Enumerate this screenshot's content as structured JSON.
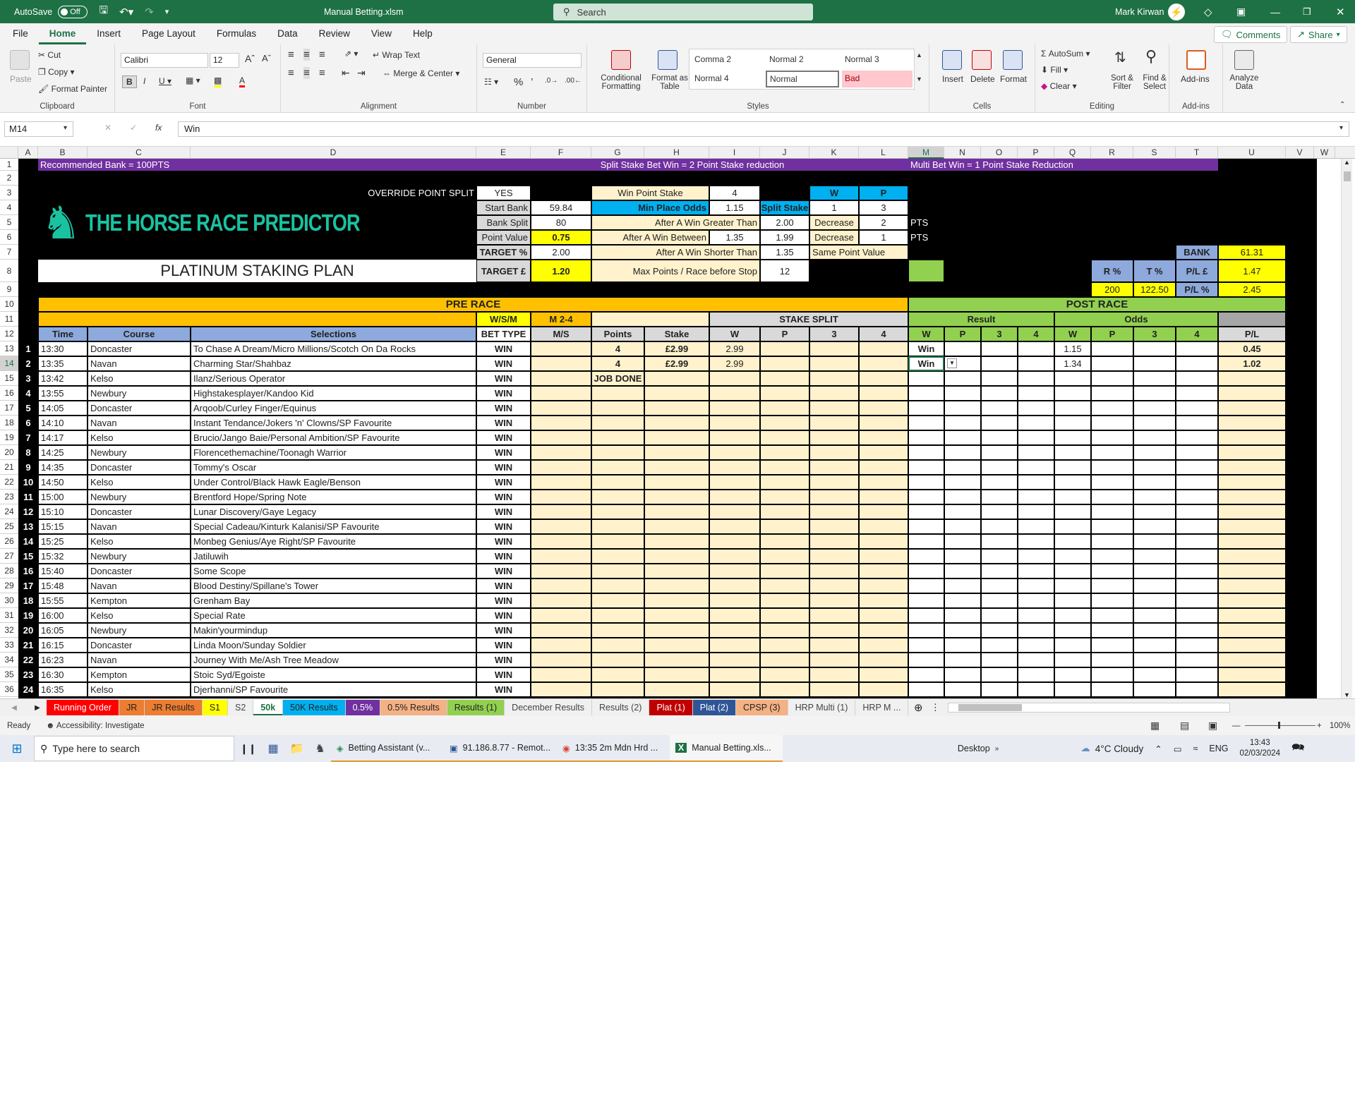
{
  "titlebar": {
    "autosave_label": "AutoSave",
    "autosave_state": "Off",
    "filename": "Manual Betting.xlsm",
    "search_placeholder": "Search",
    "user": "Mark Kirwan"
  },
  "menu": {
    "tabs": [
      "File",
      "Home",
      "Insert",
      "Page Layout",
      "Formulas",
      "Data",
      "Review",
      "View",
      "Help"
    ],
    "comments": "Comments",
    "share": "Share"
  },
  "ribbon": {
    "clipboard": {
      "label": "Clipboard",
      "paste": "Paste",
      "cut": "Cut",
      "copy": "Copy",
      "format_painter": "Format Painter"
    },
    "font": {
      "label": "Font",
      "font_name": "Calibri",
      "font_size": "12"
    },
    "alignment": {
      "label": "Alignment",
      "wrap": "Wrap Text",
      "merge": "Merge & Center"
    },
    "number": {
      "label": "Number",
      "format": "General"
    },
    "styles": {
      "label": "Styles",
      "conditional": "Conditional Formatting",
      "format_table": "Format as Table",
      "cells": [
        "Comma 2",
        "Normal 2",
        "Normal 3",
        "Normal 4",
        "Normal",
        "Bad"
      ]
    },
    "cells": {
      "label": "Cells",
      "insert": "Insert",
      "delete": "Delete",
      "format": "Format"
    },
    "editing": {
      "label": "Editing",
      "autosum": "AutoSum",
      "fill": "Fill",
      "clear": "Clear",
      "sort": "Sort & Filter",
      "find": "Find & Select"
    },
    "addins": {
      "label": "Add-ins",
      "addins": "Add-ins",
      "analyze": "Analyze Data"
    }
  },
  "formula_bar": {
    "namebox": "M14",
    "formula": "Win"
  },
  "columns": [
    "A",
    "B",
    "C",
    "D",
    "E",
    "F",
    "G",
    "H",
    "I",
    "J",
    "K",
    "L",
    "M",
    "N",
    "O",
    "P",
    "Q",
    "R",
    "S",
    "T",
    "U",
    "V",
    "W"
  ],
  "rows": [
    "1",
    "2",
    "3",
    "4",
    "5",
    "6",
    "7",
    "8",
    "9",
    "10",
    "11",
    "12",
    "13",
    "14",
    "15",
    "16",
    "17",
    "18",
    "19",
    "20",
    "21",
    "22",
    "23",
    "24",
    "25",
    "26",
    "27",
    "28",
    "29",
    "30",
    "31",
    "32",
    "33",
    "34",
    "35",
    "36"
  ],
  "sheet": {
    "banner": {
      "left": "Recommended Bank = 100PTS",
      "mid": "Split Stake Bet Win = 2 Point Stake reduction",
      "right": "Multi Bet Win = 1 Point  Stake Reduction"
    },
    "logo_title": "THE HORSE RACE PREDICTOR",
    "plan_title": "PLATINUM STAKING PLAN",
    "settings": {
      "override_label": "OVERRIDE POINT SPLIT",
      "override_val": "YES",
      "start_bank_label": "Start Bank",
      "start_bank": "59.84",
      "bank_split_label": "Bank Split",
      "bank_split": "80",
      "point_value_label": "Point Value",
      "point_value": "0.75",
      "target_pct_label": "TARGET %",
      "target_pct": "2.00",
      "target_gbp_label": "TARGET £",
      "target_gbp": "1.20",
      "win_point_stake_label": "Win Point Stake",
      "win_point_stake": "4",
      "min_place_odds_label": "Min Place Odds",
      "min_place_odds": "1.15",
      "after_win_greater_label": "After A Win Greater Than",
      "after_win_greater": "2.00",
      "after_win_between_label": "After A Win Between",
      "after_win_between": "1.35",
      "after_win_between_2": "1.99",
      "after_win_shorter_label": "After A Win Shorter Than",
      "after_win_shorter": "1.35",
      "max_points_label": "Max Points / Race before Stop",
      "max_points": "12",
      "split_stake_label": "Split Stake",
      "w_label": "W",
      "p_label": "P",
      "split_w": "1",
      "split_p": "3",
      "decrease_label": "Decrease",
      "decrease_1": "2",
      "decrease_2": "1",
      "pts": "PTS",
      "same_point": "Same Point Value"
    },
    "summary": {
      "bank_label": "BANK",
      "bank": "61.31",
      "r_pct_label": "R %",
      "t_pct_label": "T %",
      "pl_gbp_label": "P/L  £",
      "pl_gbp": "1.47",
      "r_pct": "200",
      "t_pct": "122.50",
      "pl_pct_label": "P/L %",
      "pl_pct": "2.45"
    },
    "headers": {
      "pre_race": "PRE RACE",
      "post_race": "POST RACE",
      "wsm": "W/S/M",
      "m24": "M 2-4",
      "stake_split": "STAKE SPLIT",
      "result": "Result",
      "odds": "Odds",
      "time": "Time",
      "course": "Course",
      "selections": "Selections",
      "bet_type": "BET TYPE",
      "ms": "M/S",
      "points": "Points",
      "stake": "Stake",
      "w": "W",
      "p": "P",
      "three": "3",
      "four": "4",
      "pl": "P/L"
    },
    "races": [
      {
        "n": "1",
        "time": "13:30",
        "course": "Doncaster",
        "sel": "To Chase A Dream/Micro Millions/Scotch On Da Rocks",
        "bet": "WIN",
        "points": "4",
        "stake": "£2.99",
        "sw": "2.99",
        "res": "Win",
        "odds": "1.15",
        "pl": "0.45"
      },
      {
        "n": "2",
        "time": "13:35",
        "course": "Navan",
        "sel": "Charming Star/Shahbaz",
        "bet": "WIN",
        "points": "4",
        "stake": "£2.99",
        "sw": "2.99",
        "res": "Win",
        "odds": "1.34",
        "pl": "1.02"
      },
      {
        "n": "3",
        "time": "13:42",
        "course": "Kelso",
        "sel": "Ilanz/Serious Operator",
        "bet": "WIN",
        "points": "JOB DONE",
        "stake": "",
        "sw": "",
        "res": "",
        "odds": "",
        "pl": ""
      },
      {
        "n": "4",
        "time": "13:55",
        "course": "Newbury",
        "sel": "Highstakesplayer/Kandoo Kid",
        "bet": "WIN",
        "points": "",
        "stake": "",
        "sw": "",
        "res": "",
        "odds": "",
        "pl": ""
      },
      {
        "n": "5",
        "time": "14:05",
        "course": "Doncaster",
        "sel": "Arqoob/Curley Finger/Equinus",
        "bet": "WIN",
        "points": "",
        "stake": "",
        "sw": "",
        "res": "",
        "odds": "",
        "pl": ""
      },
      {
        "n": "6",
        "time": "14:10",
        "course": "Navan",
        "sel": "Instant Tendance/Jokers 'n' Clowns/SP Favourite",
        "bet": "WIN",
        "points": "",
        "stake": "",
        "sw": "",
        "res": "",
        "odds": "",
        "pl": ""
      },
      {
        "n": "7",
        "time": "14:17",
        "course": "Kelso",
        "sel": "Brucio/Jango Baie/Personal Ambition/SP Favourite",
        "bet": "WIN",
        "points": "",
        "stake": "",
        "sw": "",
        "res": "",
        "odds": "",
        "pl": ""
      },
      {
        "n": "8",
        "time": "14:25",
        "course": "Newbury",
        "sel": "Florencethemachine/Toonagh Warrior",
        "bet": "WIN",
        "points": "",
        "stake": "",
        "sw": "",
        "res": "",
        "odds": "",
        "pl": ""
      },
      {
        "n": "9",
        "time": "14:35",
        "course": "Doncaster",
        "sel": "Tommy's Oscar",
        "bet": "WIN",
        "points": "",
        "stake": "",
        "sw": "",
        "res": "",
        "odds": "",
        "pl": ""
      },
      {
        "n": "10",
        "time": "14:50",
        "course": "Kelso",
        "sel": "Under Control/Black Hawk Eagle/Benson",
        "bet": "WIN",
        "points": "",
        "stake": "",
        "sw": "",
        "res": "",
        "odds": "",
        "pl": ""
      },
      {
        "n": "11",
        "time": "15:00",
        "course": "Newbury",
        "sel": "Brentford Hope/Spring Note",
        "bet": "WIN",
        "points": "",
        "stake": "",
        "sw": "",
        "res": "",
        "odds": "",
        "pl": ""
      },
      {
        "n": "12",
        "time": "15:10",
        "course": "Doncaster",
        "sel": "Lunar Discovery/Gaye Legacy",
        "bet": "WIN",
        "points": "",
        "stake": "",
        "sw": "",
        "res": "",
        "odds": "",
        "pl": ""
      },
      {
        "n": "13",
        "time": "15:15",
        "course": "Navan",
        "sel": "Special Cadeau/Kinturk Kalanisi/SP Favourite",
        "bet": "WIN",
        "points": "",
        "stake": "",
        "sw": "",
        "res": "",
        "odds": "",
        "pl": ""
      },
      {
        "n": "14",
        "time": "15:25",
        "course": "Kelso",
        "sel": "Monbeg Genius/Aye Right/SP Favourite",
        "bet": "WIN",
        "points": "",
        "stake": "",
        "sw": "",
        "res": "",
        "odds": "",
        "pl": ""
      },
      {
        "n": "15",
        "time": "15:32",
        "course": "Newbury",
        "sel": "Jatiluwih",
        "bet": "WIN",
        "points": "",
        "stake": "",
        "sw": "",
        "res": "",
        "odds": "",
        "pl": ""
      },
      {
        "n": "16",
        "time": "15:40",
        "course": "Doncaster",
        "sel": "Some Scope",
        "bet": "WIN",
        "points": "",
        "stake": "",
        "sw": "",
        "res": "",
        "odds": "",
        "pl": ""
      },
      {
        "n": "17",
        "time": "15:48",
        "course": "Navan",
        "sel": "Blood Destiny/Spillane's Tower",
        "bet": "WIN",
        "points": "",
        "stake": "",
        "sw": "",
        "res": "",
        "odds": "",
        "pl": ""
      },
      {
        "n": "18",
        "time": "15:55",
        "course": "Kempton",
        "sel": "Grenham Bay",
        "bet": "WIN",
        "points": "",
        "stake": "",
        "sw": "",
        "res": "",
        "odds": "",
        "pl": ""
      },
      {
        "n": "19",
        "time": "16:00",
        "course": "Kelso",
        "sel": "Special Rate",
        "bet": "WIN",
        "points": "",
        "stake": "",
        "sw": "",
        "res": "",
        "odds": "",
        "pl": ""
      },
      {
        "n": "20",
        "time": "16:05",
        "course": "Newbury",
        "sel": "Makin'yourmindup",
        "bet": "WIN",
        "points": "",
        "stake": "",
        "sw": "",
        "res": "",
        "odds": "",
        "pl": ""
      },
      {
        "n": "21",
        "time": "16:15",
        "course": "Doncaster",
        "sel": "Linda Moon/Sunday Soldier",
        "bet": "WIN",
        "points": "",
        "stake": "",
        "sw": "",
        "res": "",
        "odds": "",
        "pl": ""
      },
      {
        "n": "22",
        "time": "16:23",
        "course": "Navan",
        "sel": "Journey With Me/Ash Tree Meadow",
        "bet": "WIN",
        "points": "",
        "stake": "",
        "sw": "",
        "res": "",
        "odds": "",
        "pl": ""
      },
      {
        "n": "23",
        "time": "16:30",
        "course": "Kempton",
        "sel": "Stoic Syd/Egoiste",
        "bet": "WIN",
        "points": "",
        "stake": "",
        "sw": "",
        "res": "",
        "odds": "",
        "pl": ""
      },
      {
        "n": "24",
        "time": "16:35",
        "course": "Kelso",
        "sel": "Djerhanni/SP Favourite",
        "bet": "WIN",
        "points": "",
        "stake": "",
        "sw": "",
        "res": "",
        "odds": "",
        "pl": ""
      }
    ]
  },
  "sheet_tabs": [
    {
      "name": "Running Order",
      "bg": "#ff0000",
      "fg": "#ffffff"
    },
    {
      "name": "JR",
      "bg": "#ed7d31",
      "fg": "#222222"
    },
    {
      "name": "JR Results",
      "bg": "#ed7d31",
      "fg": "#222222"
    },
    {
      "name": "S1",
      "bg": "#ffff00",
      "fg": "#222222"
    },
    {
      "name": "S2",
      "bg": "#f0f0f0",
      "fg": "#444444"
    },
    {
      "name": "50k",
      "bg": "#ffffff",
      "fg": "#1e7145"
    },
    {
      "name": "50K Results",
      "bg": "#00b0f0",
      "fg": "#222222"
    },
    {
      "name": "0.5%",
      "bg": "#7030a0",
      "fg": "#ffffff"
    },
    {
      "name": "0.5% Results",
      "bg": "#f4b183",
      "fg": "#222222"
    },
    {
      "name": "Results (1)",
      "bg": "#92d050",
      "fg": "#222222"
    },
    {
      "name": "December Results",
      "bg": "#f0f0f0",
      "fg": "#444444"
    },
    {
      "name": "Results (2)",
      "bg": "#f0f0f0",
      "fg": "#444444"
    },
    {
      "name": "Plat (1)",
      "bg": "#c00000",
      "fg": "#ffffff"
    },
    {
      "name": "Plat (2)",
      "bg": "#2f5597",
      "fg": "#ffffff"
    },
    {
      "name": "CPSP (3)",
      "bg": "#f4b183",
      "fg": "#222222"
    },
    {
      "name": "HRP Multi (1)",
      "bg": "#f0f0f0",
      "fg": "#444444"
    },
    {
      "name": "HRP M ...",
      "bg": "#f0f0f0",
      "fg": "#444444"
    }
  ],
  "status": {
    "ready": "Ready",
    "accessibility": "Accessibility: Investigate",
    "zoom": "100%"
  },
  "taskbar": {
    "search_placeholder": "Type here to search",
    "apps": [
      "Betting Assistant (v...",
      "91.186.8.77 - Remot...",
      "13:35 2m Mdn Hrd ...",
      "Manual Betting.xls..."
    ],
    "desktop": "Desktop",
    "weather": "4°C  Cloudy",
    "lang": "ENG",
    "time": "13:43",
    "date": "02/03/2024"
  },
  "colors": {
    "excel_green": "#1e7145",
    "banner_purple": "#7030a0",
    "pre_race_orange": "#ffc000",
    "post_race_green": "#92d050",
    "cyan": "#00b0f0",
    "light_yellow": "#fff2cc",
    "yellow": "#ffff00",
    "steel": "#8ea9db"
  }
}
